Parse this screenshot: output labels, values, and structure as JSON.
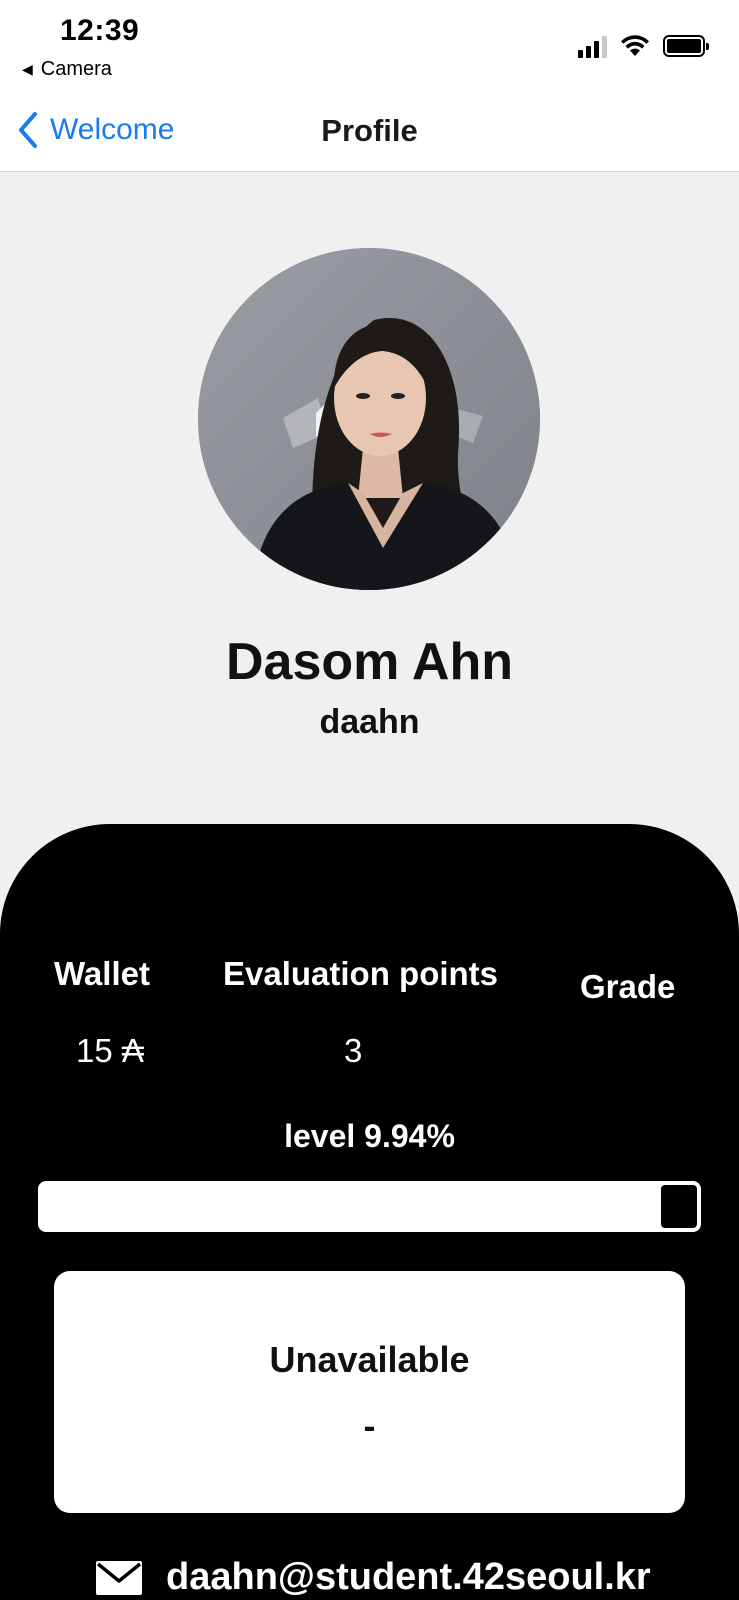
{
  "status_bar": {
    "time": "12:39",
    "back_app": "Camera"
  },
  "nav": {
    "back_label": "Welcome",
    "title": "Profile"
  },
  "profile": {
    "full_name": "Dasom Ahn",
    "login": "daahn"
  },
  "stats": {
    "wallet_label": "Wallet",
    "wallet_value": "15 ₳",
    "evaluation_label": "Evaluation points",
    "evaluation_value": "3",
    "grade_label": "Grade",
    "grade_value": ""
  },
  "level": {
    "text": "level 9.94%",
    "progress": 0.94
  },
  "card": {
    "title": "Unavailable",
    "subtitle": "-"
  },
  "contact": {
    "email": "daahn@student.42seoul.kr"
  },
  "colors": {
    "accent": "#1a7cf0",
    "panel": "#000000",
    "background": "#f0f0f0"
  }
}
